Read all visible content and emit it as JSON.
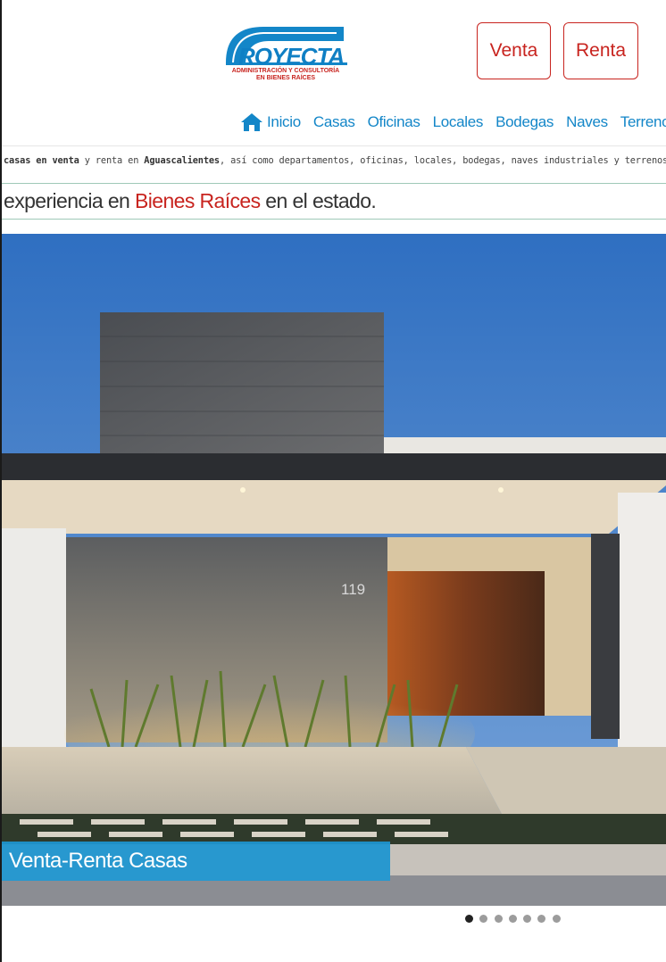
{
  "brand": {
    "logo_text": "ROYECTA",
    "logo_tagline_1": "ADMINISTRACIÓN Y CONSULTORÍA",
    "logo_tagline_2": "EN BIENES RAÍCES",
    "primary_color": "#1386c8",
    "accent_color": "#c8241f"
  },
  "header_buttons": {
    "venta": "Venta",
    "renta": "Renta"
  },
  "nav": {
    "home_icon": "home-icon",
    "items": [
      "Inicio",
      "Casas",
      "Oficinas",
      "Locales",
      "Bodegas",
      "Naves",
      "Terrenos"
    ]
  },
  "intro": {
    "part1": "casas en venta",
    "part2": " y renta en ",
    "part3": "Aguascalientes",
    "part4": ", así como departamentos, oficinas, locales, bodegas, naves industriales y terrenos."
  },
  "tagline": {
    "before": "experiencia en ",
    "highlight": "Bienes Raíces",
    "after": " en el estado."
  },
  "slider": {
    "caption": "Venta-Renta Casas",
    "house_number": "119",
    "slide_count": 7,
    "active_index": 0
  }
}
